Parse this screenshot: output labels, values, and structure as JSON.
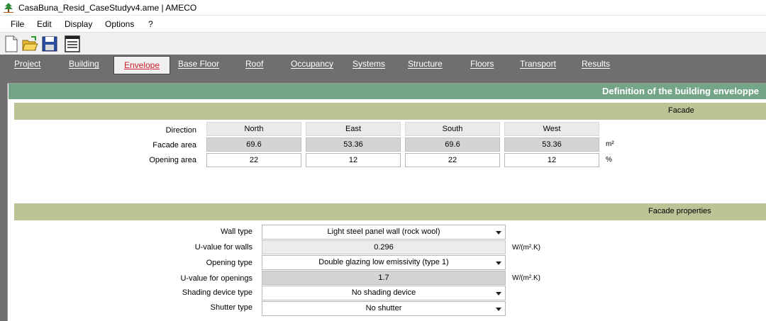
{
  "window": {
    "title": "CasaBuna_Resid_CaseStudyv4.ame | AMECO"
  },
  "menu": {
    "file": "File",
    "edit": "Edit",
    "display": "Display",
    "options": "Options",
    "help": "?"
  },
  "tabs": {
    "project": "Project",
    "building": "Building",
    "envelope": "Envelope",
    "base_floor": "Base Floor",
    "roof": "Roof",
    "occupancy": "Occupancy",
    "systems": "Systems",
    "structure": "Structure",
    "floors": "Floors",
    "transport": "Transport",
    "results": "Results",
    "active": "envelope"
  },
  "header": {
    "title": "Definition of the building enveloppe"
  },
  "facade": {
    "section_title": "Facade",
    "row_labels": {
      "direction": "Direction",
      "facade_area": "Facade area",
      "opening_area": "Opening area"
    },
    "directions": [
      "North",
      "East",
      "South",
      "West"
    ],
    "facade_area": [
      "69.6",
      "53.36",
      "69.6",
      "53.36"
    ],
    "opening_area": [
      "22",
      "12",
      "22",
      "12"
    ],
    "facade_area_unit": "m²",
    "opening_area_unit": "%"
  },
  "facade_properties": {
    "section_title": "Facade properties",
    "wall_type": {
      "label": "Wall type",
      "value": "Light steel panel wall (rock wool)"
    },
    "u_walls": {
      "label": "U-value for walls",
      "value": "0.296",
      "unit": "W/(m².K)"
    },
    "opening_type": {
      "label": "Opening type",
      "value": "Double glazing low emissivity (type 1)"
    },
    "u_openings": {
      "label": "U-value for openings",
      "value": "1.7",
      "unit": "W/(m².K)"
    },
    "shading": {
      "label": "Shading device type",
      "value": "No shading device"
    },
    "shutter": {
      "label": "Shutter type",
      "value": "No shutter"
    }
  },
  "colors": {
    "header_green": "#74a587",
    "section_olive": "#bcc394",
    "tab_bar": "#6f6f6f",
    "active_tab_text": "#d0202a"
  }
}
